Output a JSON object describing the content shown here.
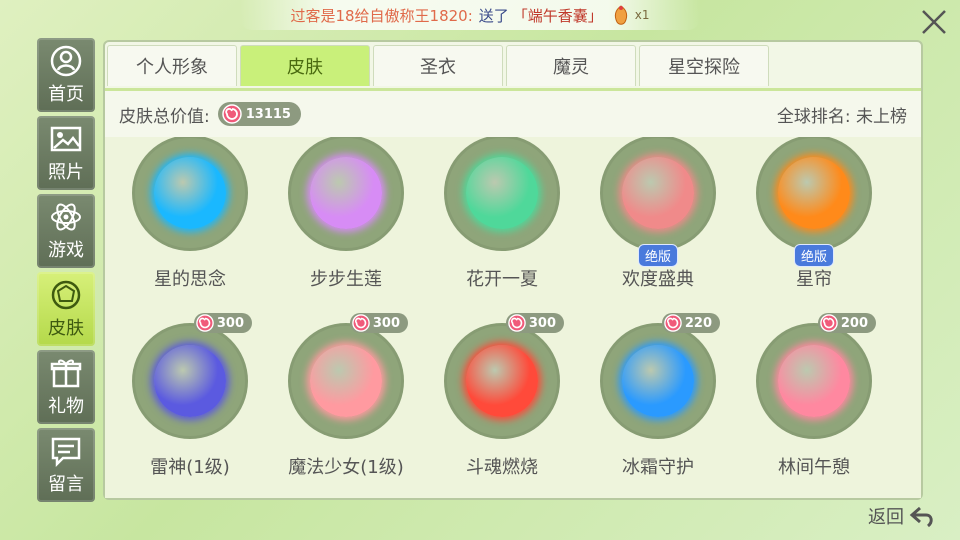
{
  "broadcast": {
    "prefix": "过客是18",
    "mid": "给自傲称王1820:",
    "sent": "送了",
    "gift": "「端午香囊」",
    "count": "x1"
  },
  "sidebar": [
    {
      "label": "首页",
      "icon": "user-icon"
    },
    {
      "label": "照片",
      "icon": "photo-icon"
    },
    {
      "label": "游戏",
      "icon": "atom-icon"
    },
    {
      "label": "皮肤",
      "icon": "ball-icon",
      "active": true
    },
    {
      "label": "礼物",
      "icon": "gift-icon"
    },
    {
      "label": "留言",
      "icon": "message-icon"
    }
  ],
  "tabs": [
    "个人形象",
    "皮肤",
    "圣衣",
    "魔灵",
    "星空探险"
  ],
  "active_tab": 1,
  "value_bar": {
    "label": "皮肤总价值:",
    "total": "13115",
    "rank": "全球排名: 未上榜"
  },
  "skins_row1": [
    {
      "name": "星的思念",
      "color": "#1ab8ff"
    },
    {
      "name": "步步生莲",
      "color": "#d78cf5"
    },
    {
      "name": "花开一夏",
      "color": "#4fd89a"
    },
    {
      "name": "欢度盛典",
      "color": "#f08a8a",
      "badge": "绝版"
    },
    {
      "name": "星帘",
      "color": "#ff8a1a",
      "badge": "绝版"
    }
  ],
  "skins_row2": [
    {
      "name": "雷神(1级)",
      "price": "300",
      "color": "#5b5ae0"
    },
    {
      "name": "魔法少女(1级)",
      "price": "300",
      "color": "#ff9aa0"
    },
    {
      "name": "斗魂燃烧",
      "price": "300",
      "color": "#ff4a3a"
    },
    {
      "name": "冰霜守护",
      "price": "220",
      "color": "#2a9aff"
    },
    {
      "name": "林间午憩",
      "price": "200",
      "color": "#ff88a0"
    }
  ],
  "back_label": "返回"
}
